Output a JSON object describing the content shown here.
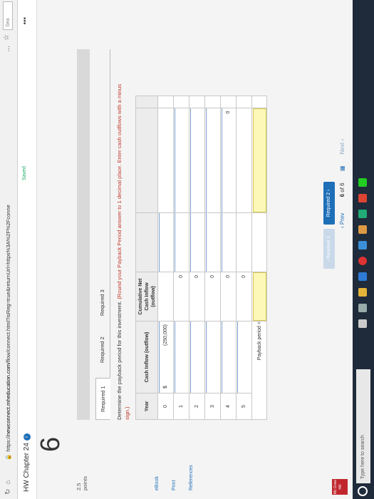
{
  "browser": {
    "url_prefix": "https://",
    "url_host": "newconnect.mheducation.com",
    "url_rest": "/flow/connect.html?isReg=true&returnUrl=https%3A%2F%2Fconne",
    "menu": "...",
    "search_placeholder": "Sea"
  },
  "header": {
    "title": "HW Chapter 24",
    "info_icon": "i",
    "saved": "Saved"
  },
  "question": {
    "number": "6",
    "points_value": "2.5",
    "points_label": "points"
  },
  "side_links": [
    "eBook",
    "Print",
    "References"
  ],
  "tabs": [
    "Required 1",
    "Required 2",
    "Required 3"
  ],
  "instructions": {
    "main": "Determine the payback period for this investment.",
    "note": "(Round your Payback Period answer to 1 decimal place. Enter cash outflows with a minus sign.)"
  },
  "table": {
    "headers": {
      "year": "Year",
      "cash_inflow": "Cash Inflow (outflow)",
      "cumulative": "Cumulative Net Cash Inflow (outflow)"
    },
    "rows": [
      {
        "year": "0",
        "dollar": "$",
        "cash": "(250,000)",
        "cum": ""
      },
      {
        "year": "1",
        "dollar": "",
        "cash": "",
        "cum": "0"
      },
      {
        "year": "2",
        "dollar": "",
        "cash": "",
        "cum": "0"
      },
      {
        "year": "3",
        "dollar": "",
        "cash": "",
        "cum": "0"
      },
      {
        "year": "4",
        "dollar": "",
        "cash": "",
        "cum": "0"
      },
      {
        "year": "5",
        "dollar": "",
        "cash": "",
        "cum": "0"
      }
    ],
    "total_value": "0",
    "payback_label": "Payback period ="
  },
  "buttons": {
    "prev_required": "Required 1",
    "next_required": "Required 2"
  },
  "pager": {
    "prev": "Prev",
    "current": "6",
    "of": "of",
    "total": "6",
    "next": "Next"
  },
  "logo_text": "Mc Graw Hill",
  "taskbar": {
    "search_placeholder": "Type here to search"
  },
  "colors": {
    "accent_blue": "#1e6fb8",
    "band_blue": "#4e7fae",
    "answer_yellow": "#fdf7b8"
  }
}
